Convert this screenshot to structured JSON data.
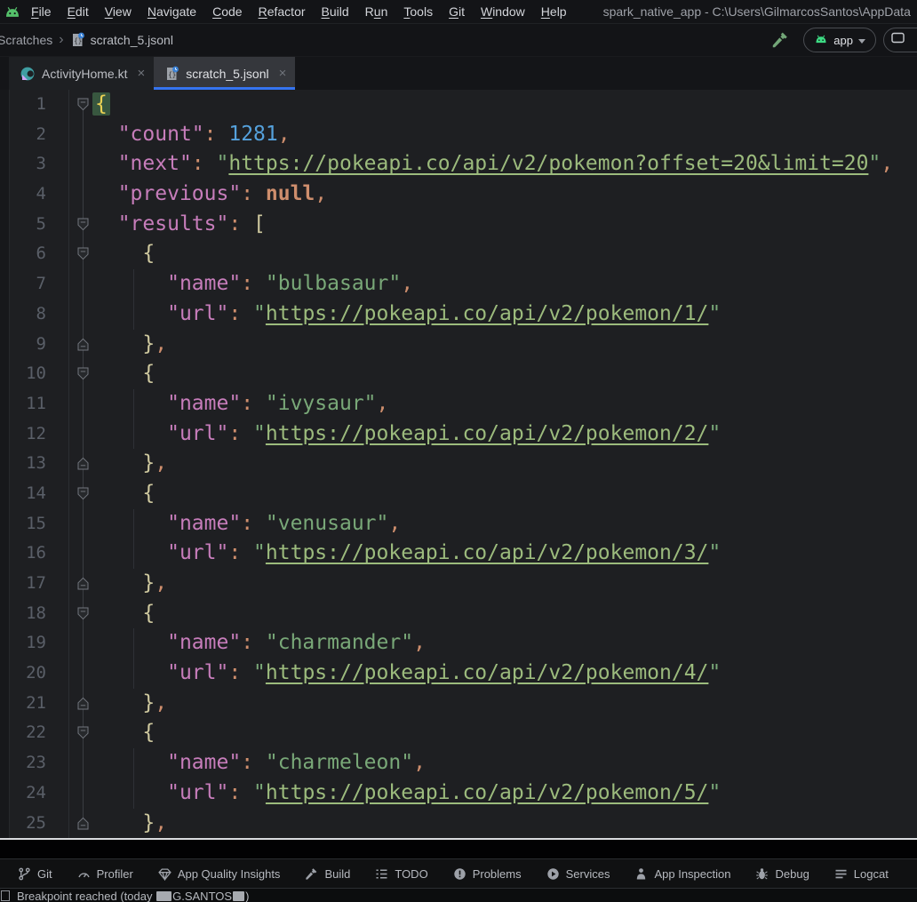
{
  "menubar": {
    "items": [
      {
        "label": "File",
        "m": 0
      },
      {
        "label": "Edit",
        "m": 0
      },
      {
        "label": "View",
        "m": 0
      },
      {
        "label": "Navigate",
        "m": 0
      },
      {
        "label": "Code",
        "m": 0
      },
      {
        "label": "Refactor",
        "m": 0
      },
      {
        "label": "Build",
        "m": 0
      },
      {
        "label": "Run",
        "m": 1
      },
      {
        "label": "Tools",
        "m": 0
      },
      {
        "label": "Git",
        "m": 0
      },
      {
        "label": "Window",
        "m": 0
      },
      {
        "label": "Help",
        "m": 0
      }
    ],
    "title": "spark_native_app - C:\\Users\\GilmarcosSantos\\AppData"
  },
  "navbar": {
    "breadcrumb": [
      "Scratches",
      "scratch_5.jsonl"
    ],
    "run_config_label": "app"
  },
  "tabs": [
    {
      "label": "ActivityHome.kt",
      "icon": "kotlin-class",
      "active": false
    },
    {
      "label": "scratch_5.jsonl",
      "icon": "json-scratch",
      "active": true
    }
  ],
  "editor": {
    "lines": [
      {
        "n": 1,
        "fold": "down",
        "tokens": [
          [
            "h",
            "{"
          ]
        ]
      },
      {
        "n": 2,
        "tokens": [
          [
            "w",
            "  "
          ],
          [
            "k",
            "\"count\""
          ],
          [
            "p",
            ": "
          ],
          [
            "n",
            "1281"
          ],
          [
            "p",
            ","
          ]
        ]
      },
      {
        "n": 3,
        "tokens": [
          [
            "w",
            "  "
          ],
          [
            "k",
            "\"next\""
          ],
          [
            "p",
            ": "
          ],
          [
            "s",
            "\""
          ],
          [
            "u",
            "https://pokeapi.co/api/v2/pokemon?offset=20&limit=20"
          ],
          [
            "s",
            "\""
          ],
          [
            "p",
            ","
          ]
        ]
      },
      {
        "n": 4,
        "tokens": [
          [
            "w",
            "  "
          ],
          [
            "k",
            "\"previous\""
          ],
          [
            "p",
            ": "
          ],
          [
            "x",
            "null"
          ],
          [
            "p",
            ","
          ]
        ]
      },
      {
        "n": 5,
        "fold": "down",
        "tokens": [
          [
            "w",
            "  "
          ],
          [
            "k",
            "\"results\""
          ],
          [
            "p",
            ": "
          ],
          [
            "b",
            "["
          ]
        ]
      },
      {
        "n": 6,
        "fold": "down",
        "tokens": [
          [
            "w",
            "    "
          ],
          [
            "b",
            "{"
          ]
        ]
      },
      {
        "n": 7,
        "g": true,
        "tokens": [
          [
            "w",
            "      "
          ],
          [
            "k",
            "\"name\""
          ],
          [
            "p",
            ": "
          ],
          [
            "s",
            "\"bulbasaur\""
          ],
          [
            "p",
            ","
          ]
        ]
      },
      {
        "n": 8,
        "g": true,
        "tokens": [
          [
            "w",
            "      "
          ],
          [
            "k",
            "\"url\""
          ],
          [
            "p",
            ": "
          ],
          [
            "s",
            "\""
          ],
          [
            "u",
            "https://pokeapi.co/api/v2/pokemon/1/"
          ],
          [
            "s",
            "\""
          ]
        ]
      },
      {
        "n": 9,
        "fold": "up",
        "tokens": [
          [
            "w",
            "    "
          ],
          [
            "b",
            "}"
          ],
          [
            "p",
            ","
          ]
        ]
      },
      {
        "n": 10,
        "fold": "down",
        "tokens": [
          [
            "w",
            "    "
          ],
          [
            "b",
            "{"
          ]
        ]
      },
      {
        "n": 11,
        "g": true,
        "tokens": [
          [
            "w",
            "      "
          ],
          [
            "k",
            "\"name\""
          ],
          [
            "p",
            ": "
          ],
          [
            "s",
            "\"ivysaur\""
          ],
          [
            "p",
            ","
          ]
        ]
      },
      {
        "n": 12,
        "g": true,
        "tokens": [
          [
            "w",
            "      "
          ],
          [
            "k",
            "\"url\""
          ],
          [
            "p",
            ": "
          ],
          [
            "s",
            "\""
          ],
          [
            "u",
            "https://pokeapi.co/api/v2/pokemon/2/"
          ],
          [
            "s",
            "\""
          ]
        ]
      },
      {
        "n": 13,
        "fold": "up",
        "tokens": [
          [
            "w",
            "    "
          ],
          [
            "b",
            "}"
          ],
          [
            "p",
            ","
          ]
        ]
      },
      {
        "n": 14,
        "fold": "down",
        "tokens": [
          [
            "w",
            "    "
          ],
          [
            "b",
            "{"
          ]
        ]
      },
      {
        "n": 15,
        "g": true,
        "tokens": [
          [
            "w",
            "      "
          ],
          [
            "k",
            "\"name\""
          ],
          [
            "p",
            ": "
          ],
          [
            "s",
            "\"venusaur\""
          ],
          [
            "p",
            ","
          ]
        ]
      },
      {
        "n": 16,
        "g": true,
        "tokens": [
          [
            "w",
            "      "
          ],
          [
            "k",
            "\"url\""
          ],
          [
            "p",
            ": "
          ],
          [
            "s",
            "\""
          ],
          [
            "u",
            "https://pokeapi.co/api/v2/pokemon/3/"
          ],
          [
            "s",
            "\""
          ]
        ]
      },
      {
        "n": 17,
        "fold": "up",
        "tokens": [
          [
            "w",
            "    "
          ],
          [
            "b",
            "}"
          ],
          [
            "p",
            ","
          ]
        ]
      },
      {
        "n": 18,
        "fold": "down",
        "tokens": [
          [
            "w",
            "    "
          ],
          [
            "b",
            "{"
          ]
        ]
      },
      {
        "n": 19,
        "g": true,
        "tokens": [
          [
            "w",
            "      "
          ],
          [
            "k",
            "\"name\""
          ],
          [
            "p",
            ": "
          ],
          [
            "s",
            "\"charmander\""
          ],
          [
            "p",
            ","
          ]
        ]
      },
      {
        "n": 20,
        "g": true,
        "tokens": [
          [
            "w",
            "      "
          ],
          [
            "k",
            "\"url\""
          ],
          [
            "p",
            ": "
          ],
          [
            "s",
            "\""
          ],
          [
            "u",
            "https://pokeapi.co/api/v2/pokemon/4/"
          ],
          [
            "s",
            "\""
          ]
        ]
      },
      {
        "n": 21,
        "fold": "up",
        "tokens": [
          [
            "w",
            "    "
          ],
          [
            "b",
            "}"
          ],
          [
            "p",
            ","
          ]
        ]
      },
      {
        "n": 22,
        "fold": "down",
        "tokens": [
          [
            "w",
            "    "
          ],
          [
            "b",
            "{"
          ]
        ]
      },
      {
        "n": 23,
        "g": true,
        "tokens": [
          [
            "w",
            "      "
          ],
          [
            "k",
            "\"name\""
          ],
          [
            "p",
            ": "
          ],
          [
            "s",
            "\"charmeleon\""
          ],
          [
            "p",
            ","
          ]
        ]
      },
      {
        "n": 24,
        "g": true,
        "tokens": [
          [
            "w",
            "      "
          ],
          [
            "k",
            "\"url\""
          ],
          [
            "p",
            ": "
          ],
          [
            "s",
            "\""
          ],
          [
            "u",
            "https://pokeapi.co/api/v2/pokemon/5/"
          ],
          [
            "s",
            "\""
          ]
        ]
      },
      {
        "n": 25,
        "fold": "up",
        "tokens": [
          [
            "w",
            "    "
          ],
          [
            "b",
            "}"
          ],
          [
            "p",
            ","
          ]
        ]
      }
    ]
  },
  "bottom_toolbar": {
    "items": [
      {
        "label": "Git",
        "icon": "git-branch"
      },
      {
        "label": "Profiler",
        "icon": "profiler-gauge"
      },
      {
        "label": "App Quality Insights",
        "icon": "gem"
      },
      {
        "label": "Build",
        "icon": "hammer-gray"
      },
      {
        "label": "TODO",
        "icon": "todo-list"
      },
      {
        "label": "Problems",
        "icon": "problems"
      },
      {
        "label": "Services",
        "icon": "services-play"
      },
      {
        "label": "App Inspection",
        "icon": "app-inspection"
      },
      {
        "label": "Debug",
        "icon": "debug-bug"
      },
      {
        "label": "Logcat",
        "icon": "logcat-lines"
      }
    ]
  },
  "statusbar": {
    "text_before": "Breakpoint reached (today ",
    "redacted_label": "G.SANTOS",
    "text_after": ")"
  },
  "colors": {
    "accent_blue": "#3574F0",
    "android_green": "#54C06A",
    "json_key": "#C77DBB",
    "json_string": "#79A878",
    "json_number": "#55A1DC",
    "json_keyword": "#CE8E6D"
  }
}
